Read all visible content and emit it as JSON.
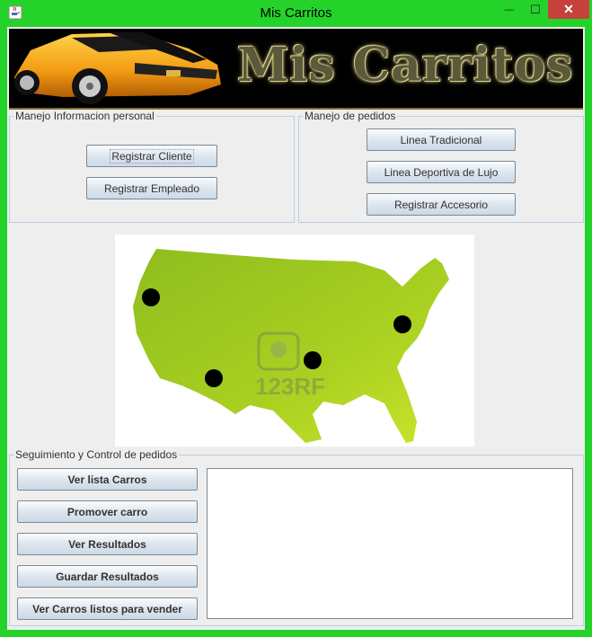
{
  "window": {
    "title": "Mis Carritos",
    "close_glyph": "✕",
    "min_glyph": "—",
    "max_glyph": "☐"
  },
  "banner": {
    "title": "Mis Carritos"
  },
  "personal": {
    "legend": "Manejo Informacion personal",
    "buttons": [
      "Registrar Cliente",
      "Registrar Empleado"
    ]
  },
  "pedidos": {
    "legend": "Manejo de pedidos",
    "buttons": [
      "Linea Tradicional",
      "Linea Deportiva de Lujo",
      "Registrar Accesorio"
    ]
  },
  "map": {
    "watermark": "123RF"
  },
  "seguimiento": {
    "legend": "Seguimiento y Control de pedidos",
    "buttons": [
      "Ver lista Carros",
      "Promover carro",
      "Ver Resultados",
      "Guardar Resultados",
      "Ver Carros listos para vender"
    ],
    "output_text": ""
  },
  "colors": {
    "frame": "#24d32a",
    "close": "#c6413b",
    "map_green": "#a4cc1e"
  },
  "icons": {
    "app": "java-coffee-icon",
    "minimize": "minimize-icon",
    "maximize": "maximize-icon",
    "close": "close-icon"
  }
}
